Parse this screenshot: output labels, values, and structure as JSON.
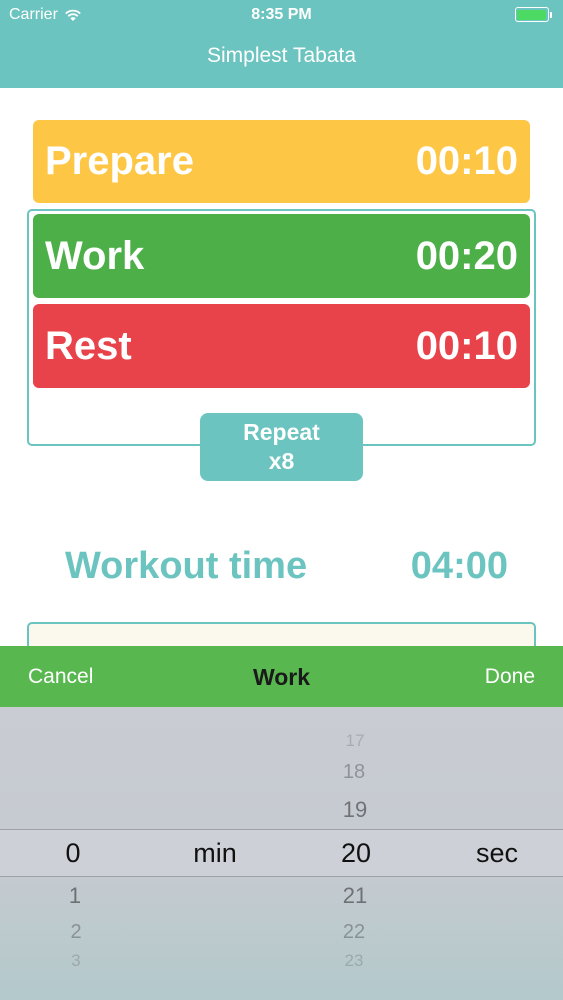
{
  "status_bar": {
    "carrier": "Carrier",
    "time": "8:35 PM"
  },
  "app": {
    "title": "Simplest Tabata"
  },
  "intervals": {
    "prepare": {
      "label": "Prepare",
      "time": "00:10",
      "color": "#fdc644"
    },
    "work": {
      "label": "Work",
      "time": "00:20",
      "color": "#4caf48"
    },
    "rest": {
      "label": "Rest",
      "time": "00:10",
      "color": "#e8434a"
    }
  },
  "repeat": {
    "line1": "Repeat",
    "line2": "x8"
  },
  "workout": {
    "label": "Workout time",
    "value": "04:00"
  },
  "picker_toolbar": {
    "cancel": "Cancel",
    "title": "Work",
    "done": "Done"
  },
  "picker": {
    "minutes": {
      "selected": "0",
      "unit": "min",
      "below": [
        "1",
        "2",
        "3"
      ]
    },
    "seconds": {
      "above": [
        "17",
        "18",
        "19"
      ],
      "selected": "20",
      "unit": "sec",
      "below": [
        "21",
        "22",
        "23"
      ]
    }
  },
  "colors": {
    "accent": "#6bc4bf",
    "toolbar": "#58b84f"
  }
}
